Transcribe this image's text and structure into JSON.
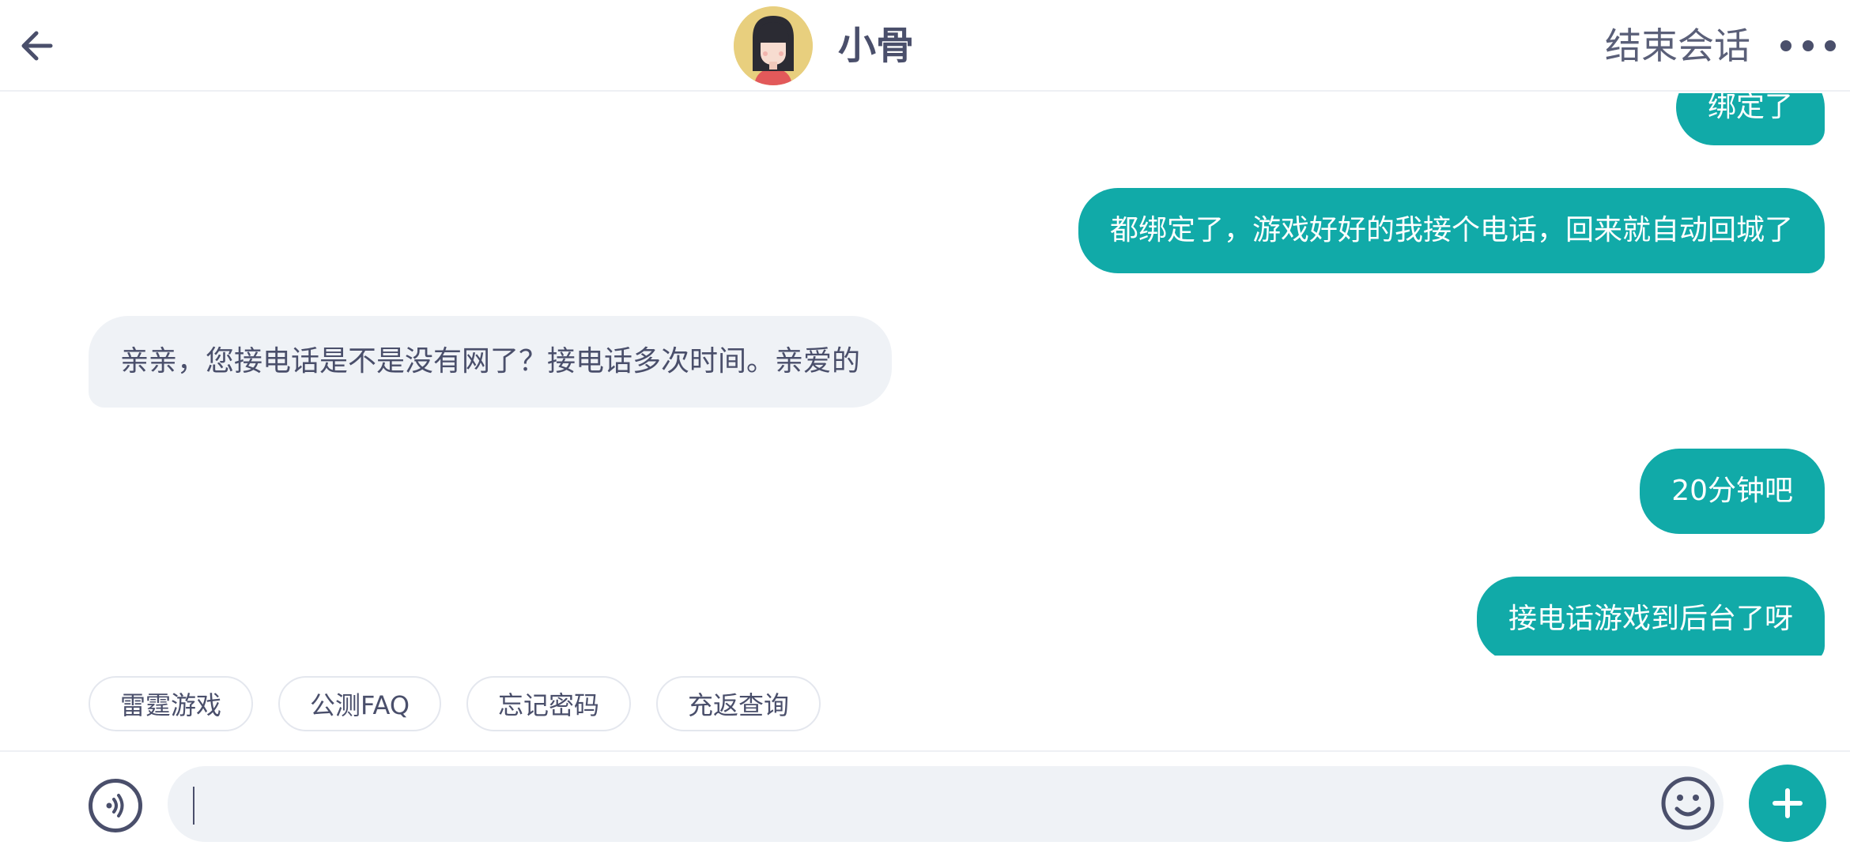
{
  "header": {
    "back_icon": "arrow-left-icon",
    "contact_name": "小骨",
    "end_chat_label": "结束会话",
    "more_icon": "more-dots-icon"
  },
  "messages": [
    {
      "direction": "outgoing",
      "text": "绑定了"
    },
    {
      "direction": "outgoing",
      "text": "都绑定了，游戏好好的我接个电话，回来就自动回城了"
    },
    {
      "direction": "incoming",
      "text": "亲亲，您接电话是不是没有网了？接电话多次时间。亲爱的"
    },
    {
      "direction": "outgoing",
      "text": "20分钟吧"
    },
    {
      "direction": "outgoing",
      "text": "接电话游戏到后台了呀"
    }
  ],
  "quick_replies": [
    "雷霆游戏",
    "公测FAQ",
    "忘记密码",
    "充返查询"
  ],
  "composer": {
    "input_value": "",
    "voice_icon": "voice-icon",
    "emoji_icon": "emoji-icon",
    "plus_icon": "plus-icon"
  },
  "colors": {
    "accent": "#11aaa8",
    "incoming_bubble": "#eff2f6",
    "text": "#4a4f6b"
  }
}
